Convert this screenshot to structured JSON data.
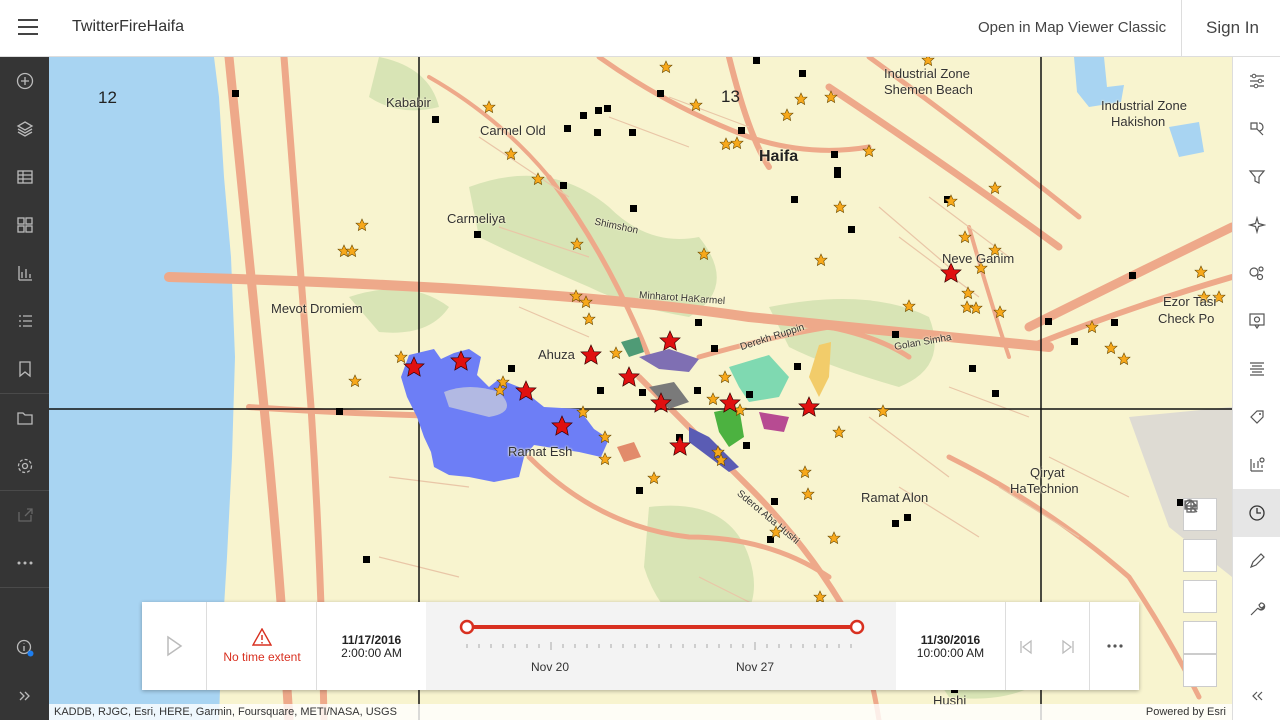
{
  "header": {
    "title": "TwitterFireHaifa",
    "open_classic": "Open in Map Viewer Classic",
    "sign_in": "Sign In"
  },
  "map": {
    "grid_labels": [
      "12",
      "13"
    ],
    "places": [
      {
        "name": "Kababir"
      },
      {
        "name": "Carmel Old"
      },
      {
        "name": "Haifa"
      },
      {
        "name": "Industrial Zone"
      },
      {
        "name": "Shemen Beach"
      },
      {
        "name": "Industrial Zone"
      },
      {
        "name": "Hakishon"
      },
      {
        "name": "Carmeliya"
      },
      {
        "name": "Neve Ganim"
      },
      {
        "name": "Mevot Dromiem"
      },
      {
        "name": "Ahuza"
      },
      {
        "name": "Ramat Esh"
      },
      {
        "name": "Ezor Tasi"
      },
      {
        "name": "Check Po"
      },
      {
        "name": "Qiryat"
      },
      {
        "name": "HaTechnion"
      },
      {
        "name": "Ramat Alon"
      },
      {
        "name": "Shimshon"
      },
      {
        "name": "Minharot HaKarmel"
      },
      {
        "name": "Derekh Ruppin"
      },
      {
        "name": "Golan Simha"
      },
      {
        "name": "Sderot Aba Hushi"
      },
      {
        "name": "Hushi"
      }
    ],
    "attribution": "KADDB, RJGC, Esri, HERE, Garmin, Foursquare, METI/NASA, USGS",
    "powered_by": "Powered by Esri",
    "colors": {
      "land": "#f8f4cf",
      "water": "#a8d4f2",
      "roads": "#eea98a",
      "park": "#d8e4b5",
      "star_gold": "#f7a81b",
      "star_red": "#e01010",
      "fire_blue": "#6d7ef6"
    }
  },
  "time_slider": {
    "warning": "No time extent",
    "start_date": "11/17/2016",
    "start_time": "2:00:00 AM",
    "end_date": "11/30/2016",
    "end_time": "10:00:00 AM",
    "ticks": [
      "Nov 20",
      "Nov 27"
    ]
  }
}
